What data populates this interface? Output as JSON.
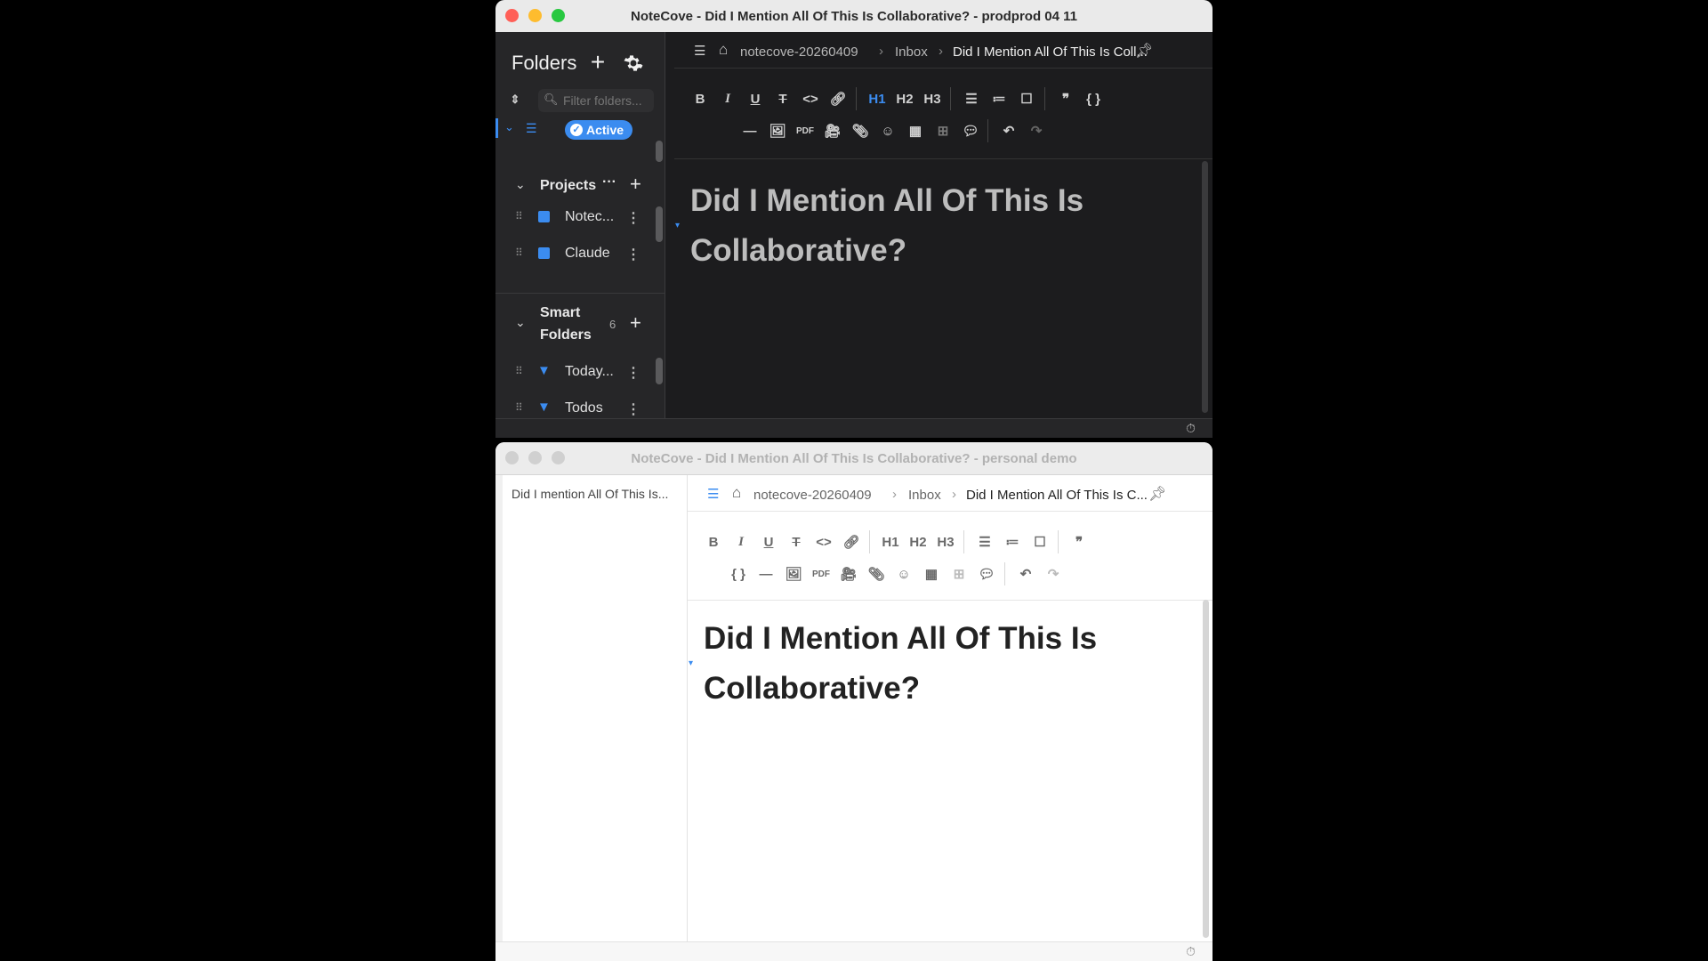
{
  "window_top": {
    "title": "NoteCove - Did I Mention All Of This Is Collaborative? - prodprod 04 11",
    "sidebar": {
      "header": "Folders",
      "filter_placeholder": "Filter folders...",
      "active_badge": "Active",
      "projects": {
        "label": "Projects",
        "items": [
          {
            "label": "Notec..."
          },
          {
            "label": "Claude"
          }
        ]
      },
      "smart_folders": {
        "label_line1": "Smart",
        "label_line2": "Folders",
        "count": "6",
        "items": [
          {
            "label": "Today..."
          },
          {
            "label": "Todos"
          }
        ]
      }
    },
    "breadcrumb": {
      "root": "notecove-20260409",
      "folder": "Inbox",
      "note": "Did I Mention All Of This Is Coll..."
    },
    "toolbar": {
      "h1": "H1",
      "h2": "H2",
      "h3": "H3"
    },
    "document": {
      "title_line1": "Did I Mention All Of This Is",
      "title_line2": "Collaborative?"
    }
  },
  "window_bottom": {
    "title": "NoteCove - Did I Mention All Of This Is Collaborative? - personal demo",
    "note_list": {
      "items": [
        {
          "label": "Did I mention All Of This Is..."
        }
      ]
    },
    "breadcrumb": {
      "root": "notecove-20260409",
      "folder": "Inbox",
      "note": "Did I Mention All Of This Is C..."
    },
    "toolbar": {
      "h1": "H1",
      "h2": "H2",
      "h3": "H3"
    },
    "document": {
      "title_line1": "Did I Mention All Of This Is",
      "title_line2": "Collaborative?"
    }
  },
  "colors": {
    "accent": "#3b8cf0",
    "dark_bg": "#1c1c1e",
    "dark_sidebar": "#262628",
    "traffic_red": "#ff5f57",
    "traffic_yellow": "#febc2e",
    "traffic_green": "#28c840"
  }
}
